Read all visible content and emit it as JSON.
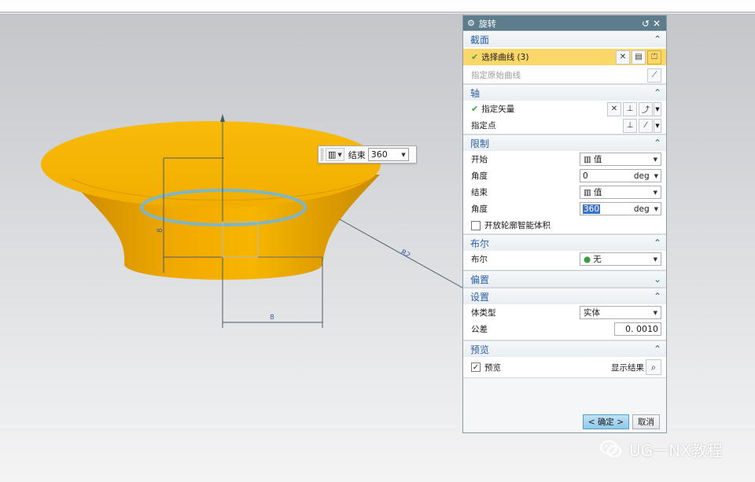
{
  "colors": {
    "titlebar": "#5e7d8c",
    "section_header": "#2c5fa8",
    "selection_highlight": "#fbd76a",
    "model_fill": "#f7b500",
    "model_side": "#e8a205",
    "dimension_line": "#4a5a66"
  },
  "viewport": {
    "dimension_left": "8",
    "dimension_bottom": "8",
    "dimension_diagonal": "R2",
    "float_input": {
      "icon": "value-icon",
      "label": "结束",
      "value": "360"
    }
  },
  "dialog": {
    "title": "旋转",
    "title_icon": "gear-icon",
    "reset_icon": "reset-icon",
    "close_icon": "close-icon",
    "sections": {
      "section": {
        "header": "截面",
        "select_curve": "选择曲线 (3)",
        "specify_origin": "指定原始曲线"
      },
      "axis": {
        "header": "轴",
        "specify_vector": "指定矢量",
        "specify_point": "指定点"
      },
      "limits": {
        "header": "限制",
        "start_label": "开始",
        "start_type": "值",
        "start_angle_label": "角度",
        "start_angle_value": "0",
        "start_angle_unit": "deg",
        "end_label": "结束",
        "end_type": "值",
        "end_angle_label": "角度",
        "end_angle_value": "360",
        "end_angle_unit": "deg",
        "open_profile": "开放轮廓智能体积"
      },
      "boolean": {
        "header": "布尔",
        "label": "布尔",
        "value": "无"
      },
      "offset": {
        "header": "偏置"
      },
      "settings": {
        "header": "设置",
        "body_type_label": "体类型",
        "body_type_value": "实体",
        "tolerance_label": "公差",
        "tolerance_value": "0. 0010"
      },
      "preview": {
        "header": "预览",
        "preview_label": "预览",
        "show_result": "显示结果"
      }
    },
    "footer": {
      "ok": "< 确定 >",
      "cancel": "取消"
    }
  },
  "watermark": {
    "text": "UG一NX教程",
    "icon": "wechat-icon"
  }
}
